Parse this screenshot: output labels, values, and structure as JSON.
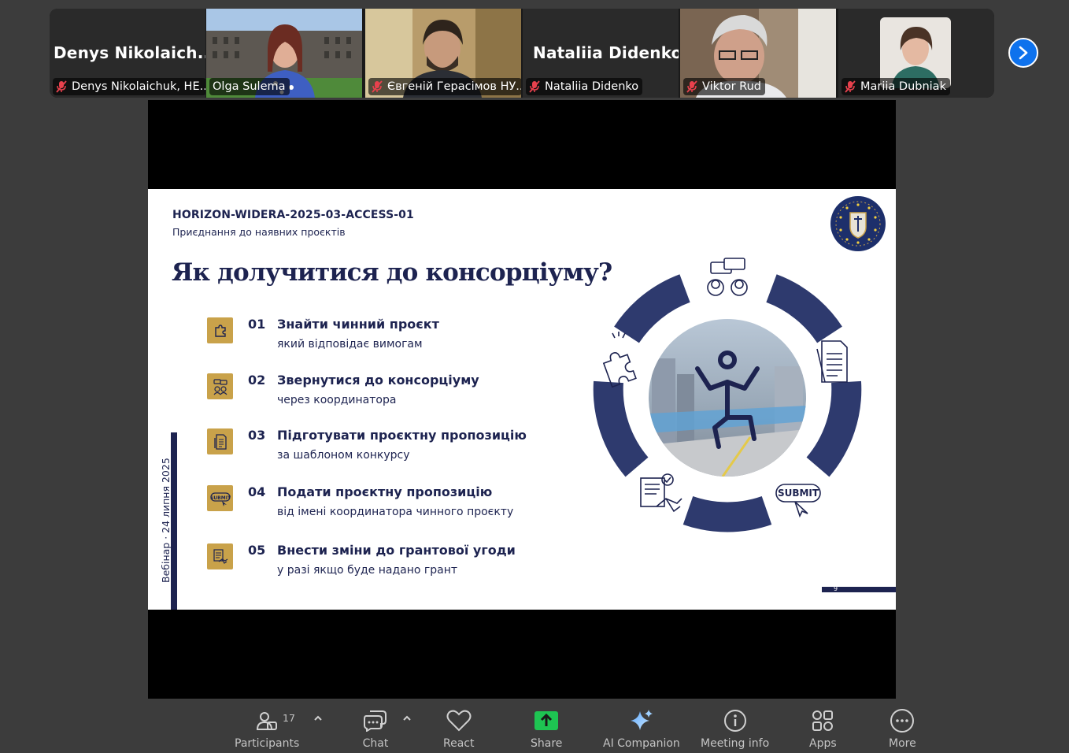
{
  "participants": [
    {
      "big_name": "Denys  Nikolaich...",
      "label": "Denys Nikolaichuk, HE..."
    },
    {
      "label": "Olga Sulema"
    },
    {
      "label": "Євгеній Герасімов НУ..."
    },
    {
      "big_name": "Nataliia Didenko",
      "label": "Nataliia Didenko"
    },
    {
      "label": "Viktor Rud"
    },
    {
      "label": "Mariia Dubniak"
    }
  ],
  "slide": {
    "code": "HORIZON-WIDERA-2025-03-ACCESS-01",
    "subtitle": "Приєднання до наявних проєктів",
    "title": "Як долучитися до консорціуму?",
    "steps": [
      {
        "num": "01",
        "head": "Знайти чинний проєкт",
        "desc": "який відповідає вимогам",
        "icon": "puzzle-icon"
      },
      {
        "num": "02",
        "head": "Звернутися до консорціуму",
        "desc": "через координатора",
        "icon": "people-chat-icon"
      },
      {
        "num": "03",
        "head": "Підготувати проєктну пропозицію",
        "desc": "за шаблоном конкурсу",
        "icon": "document-icon"
      },
      {
        "num": "04",
        "head": "Подати проєктну пропозицію",
        "desc": "від імені координатора чинного проєкту",
        "icon": "submit-icon"
      },
      {
        "num": "05",
        "head": "Внести зміни до грантової угоди",
        "desc": "у разі якщо буде надано грант",
        "icon": "agreement-icon"
      }
    ],
    "vertical_text": "Вебінар · 24 липня 2025",
    "page_number": "9",
    "submit_text": "SUBMIT"
  },
  "toolbar": {
    "participants_label": "Participants",
    "participants_count": "17",
    "chat_label": "Chat",
    "react_label": "React",
    "share_label": "Share",
    "ai_label": "AI Companion",
    "meeting_info_label": "Meeting info",
    "apps_label": "Apps",
    "more_label": "More"
  },
  "colors": {
    "accent_blue": "#0e72ed",
    "active_speaker": "#23d959",
    "share_green": "#1ec452",
    "slide_navy": "#1d2350",
    "slide_gold": "#c9a24a",
    "muted_red": "#e8414d"
  }
}
